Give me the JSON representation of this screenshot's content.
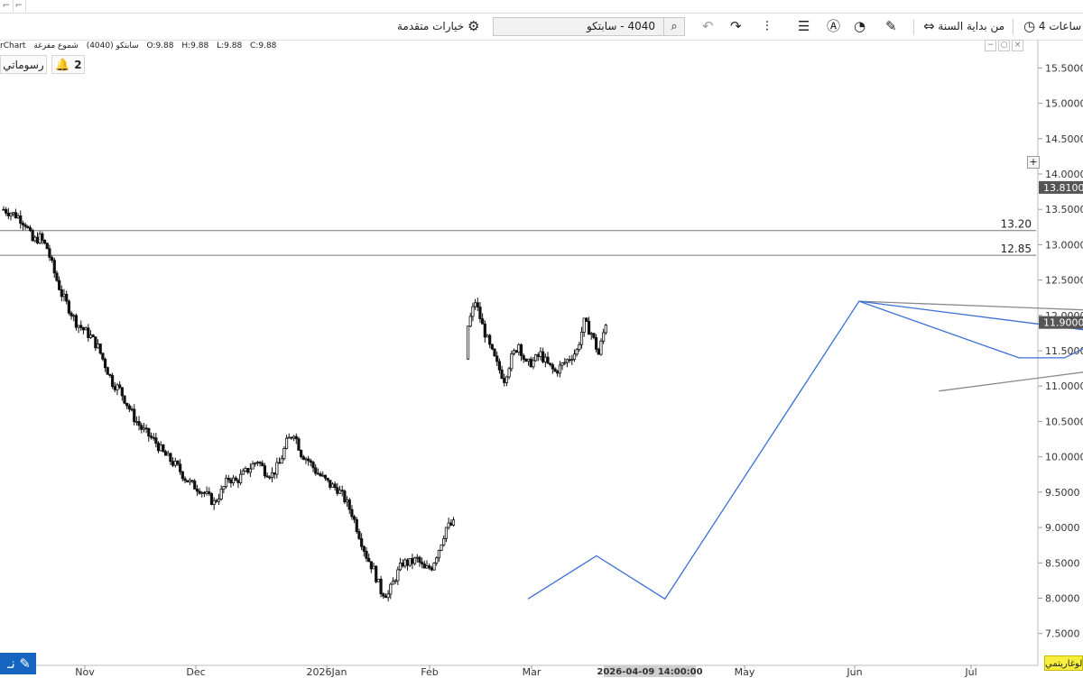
{
  "toolbar": {
    "timeframe_label": "4 ساعات",
    "range_label": "من بداية السنة",
    "search_value": "4040 - سابتكو",
    "advanced_label": "خيارات متقدمة"
  },
  "legend": {
    "chart_name": "rChart",
    "symbol_label": "سابتكو (4040)",
    "chart_type_label": "شموع مفرغة",
    "open": "O:9.88",
    "high": "H:9.88",
    "low": "L:9.88",
    "close": "C:9.88"
  },
  "drawings_button": "رسوماتي",
  "alerts_count": "2",
  "log_button": "لوغاريتمي",
  "pencil_label": "نـ",
  "crosshair_time": "2026-04-09 14:00:00",
  "colors": {
    "candle": "#111111",
    "drawing_blue": "#3b6fd6",
    "drawing_gray": "#8a8a8a",
    "price_badge": "#555555"
  },
  "chart_data": {
    "type": "candlestick",
    "y_ticks": [
      "15.5000",
      "15.0000",
      "14.5000",
      "14.0000",
      "13.5000",
      "13.0000",
      "12.5000",
      "12.0000",
      "11.5000",
      "11.0000",
      "10.5000",
      "10.0000",
      "9.5000",
      "9.0000",
      "8.5000",
      "8.0000",
      "7.5000"
    ],
    "x_ticks": [
      "Nov",
      "Dec",
      "2026Jan",
      "Feb",
      "Mar",
      "May",
      "Jun",
      "Jul"
    ],
    "ylim": [
      7.05,
      15.9
    ],
    "horizontal_levels": [
      {
        "value": 13.2,
        "label": "13.20"
      },
      {
        "value": 12.85,
        "label": "12.85"
      }
    ],
    "price_badges": [
      {
        "value": 13.81,
        "label": "13.8100"
      },
      {
        "value": 11.9,
        "label": "11.9000"
      }
    ],
    "close_path": [
      [
        0,
        13.5
      ],
      [
        3,
        13.45
      ],
      [
        6,
        13.4
      ],
      [
        9,
        13.3
      ],
      [
        12,
        13.05
      ],
      [
        15,
        13.1
      ],
      [
        18,
        12.95
      ],
      [
        21,
        12.6
      ],
      [
        24,
        12.3
      ],
      [
        27,
        12.1
      ],
      [
        30,
        11.9
      ],
      [
        33,
        11.8
      ],
      [
        36,
        11.7
      ],
      [
        39,
        11.55
      ],
      [
        42,
        11.3
      ],
      [
        45,
        11.05
      ],
      [
        48,
        10.95
      ],
      [
        51,
        10.75
      ],
      [
        54,
        10.55
      ],
      [
        57,
        10.4
      ],
      [
        60,
        10.3
      ],
      [
        63,
        10.2
      ],
      [
        66,
        10.05
      ],
      [
        69,
        9.95
      ],
      [
        72,
        9.85
      ],
      [
        75,
        9.7
      ],
      [
        78,
        9.6
      ],
      [
        81,
        9.55
      ],
      [
        84,
        9.45
      ],
      [
        87,
        9.35
      ],
      [
        90,
        9.5
      ],
      [
        93,
        9.7
      ],
      [
        96,
        9.65
      ],
      [
        99,
        9.75
      ],
      [
        102,
        9.85
      ],
      [
        105,
        9.95
      ],
      [
        108,
        9.8
      ],
      [
        111,
        9.75
      ],
      [
        114,
        9.9
      ],
      [
        117,
        10.2
      ],
      [
        120,
        10.35
      ],
      [
        123,
        10.05
      ],
      [
        126,
        9.95
      ],
      [
        129,
        9.8
      ],
      [
        132,
        9.7
      ],
      [
        135,
        9.6
      ],
      [
        138,
        9.55
      ],
      [
        141,
        9.4
      ],
      [
        144,
        9.2
      ],
      [
        147,
        8.9
      ],
      [
        150,
        8.6
      ],
      [
        153,
        8.4
      ],
      [
        156,
        8.1
      ],
      [
        159,
        8.05
      ],
      [
        162,
        8.3
      ],
      [
        165,
        8.5
      ],
      [
        168,
        8.5
      ],
      [
        171,
        8.55
      ],
      [
        174,
        8.4
      ],
      [
        177,
        8.45
      ],
      [
        180,
        8.7
      ],
      [
        183,
        9.0
      ],
      [
        186,
        9.05
      ],
      [
        192,
        11.85
      ],
      [
        195,
        12.2
      ],
      [
        198,
        11.85
      ],
      [
        201,
        11.55
      ],
      [
        204,
        11.3
      ],
      [
        207,
        11.1
      ],
      [
        210,
        11.4
      ],
      [
        213,
        11.6
      ],
      [
        216,
        11.3
      ],
      [
        219,
        11.35
      ],
      [
        222,
        11.45
      ],
      [
        225,
        11.3
      ],
      [
        228,
        11.2
      ],
      [
        231,
        11.3
      ],
      [
        234,
        11.4
      ],
      [
        237,
        11.5
      ],
      [
        240,
        11.9
      ],
      [
        243,
        11.75
      ],
      [
        246,
        11.45
      ],
      [
        249,
        11.9
      ]
    ],
    "drawings": [
      {
        "kind": "zigzag",
        "color": "blue",
        "points": [
          [
            7,
            7.99
          ],
          [
            13,
            8.6
          ],
          [
            19,
            7.99
          ],
          [
            36,
            12.2
          ],
          [
            50,
            11.4
          ],
          [
            54,
            11.4
          ],
          [
            75,
            13.05
          ]
        ]
      },
      {
        "kind": "triangle-upper",
        "color": "gray",
        "points": [
          [
            36,
            12.2
          ],
          [
            73,
            11.97
          ]
        ]
      },
      {
        "kind": "triangle-lower",
        "color": "gray",
        "points": [
          [
            43,
            10.93
          ],
          [
            70,
            11.5
          ]
        ]
      },
      {
        "kind": "pattern-line",
        "color": "blue",
        "points": [
          [
            36,
            12.2
          ],
          [
            75,
            11.4
          ]
        ]
      }
    ]
  }
}
